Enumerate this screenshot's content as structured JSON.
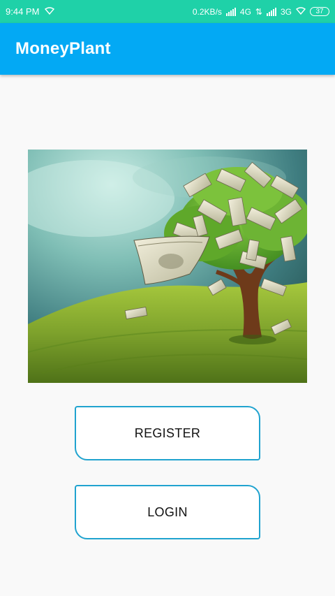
{
  "status_bar": {
    "time": "9:44 PM",
    "network_speed": "0.2KB/s",
    "network_4g": "4G",
    "network_3g": "3G",
    "battery": "37"
  },
  "app_bar": {
    "title": "MoneyPlant"
  },
  "hero": {
    "icon": "money-tree-illustration"
  },
  "buttons": {
    "register_label": "REGISTER",
    "login_label": "LOGIN"
  },
  "colors": {
    "status_bar": "#1fd1a8",
    "app_bar": "#03a9f4",
    "button_border": "#20a3cf",
    "background": "#f9f9f9"
  }
}
